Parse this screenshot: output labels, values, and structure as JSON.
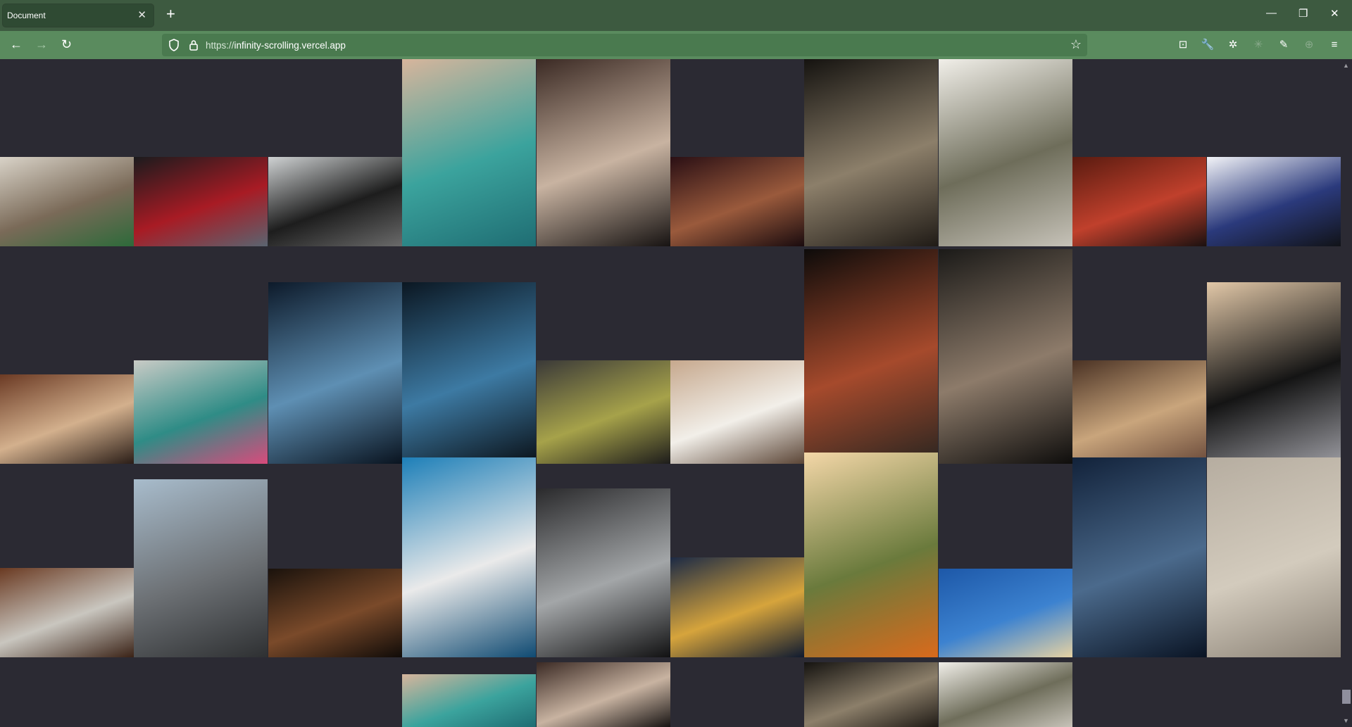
{
  "browser": {
    "tab_title": "Document",
    "tab_close": "✕",
    "new_tab": "+",
    "url_scheme": "https://",
    "url_host": "infinity-scrolling.vercel.app",
    "window_controls": {
      "minimize": "—",
      "restore": "❐",
      "close": "✕"
    },
    "nav": {
      "back": "←",
      "forward": "→",
      "reload": "↻"
    },
    "bookmark": "☆",
    "toolbar_icons": [
      "pocket-icon",
      "wrench-icon",
      "extension-icon",
      "disabled-extension-icon",
      "eyedropper-icon",
      "crosshair-icon",
      "menu-icon"
    ],
    "toolbar_glyphs": [
      "⊡",
      "🔧",
      "✲",
      "✳",
      "✎",
      "⊕",
      "≡"
    ]
  },
  "gallery": {
    "description_visible": false,
    "tiles": [
      {
        "name": "photo-laptop-plant-desk",
        "grad": [
          "#d9d3c8",
          "#7a6a58",
          "#2d6a3a"
        ]
      },
      {
        "name": "photo-red-poster-window",
        "grad": [
          "#1b1b1d",
          "#a81b24",
          "#5a6470"
        ]
      },
      {
        "name": "photo-office-windows",
        "grad": [
          "#cfd2d3",
          "#1d1d1d",
          "#6a6a6a"
        ]
      },
      {
        "name": "photo-aerial-beach",
        "grad": [
          "#d7b59c",
          "#3ba39d",
          "#1f6d73"
        ]
      },
      {
        "name": "photo-wedding-couple",
        "grad": [
          "#3b2a24",
          "#c8b3a1",
          "#171312"
        ]
      },
      {
        "name": "photo-coin-stack",
        "grad": [
          "#2a0f14",
          "#9a5a3c",
          "#1a0b0e"
        ]
      },
      {
        "name": "photo-gothic-window-city",
        "grad": [
          "#151310",
          "#8c7f6a",
          "#201b16"
        ]
      },
      {
        "name": "photo-dining-room",
        "grad": [
          "#f1efe9",
          "#6e6d5a",
          "#c6c2b8"
        ]
      },
      {
        "name": "photo-man-red-flannel",
        "grad": [
          "#5a1b10",
          "#c0402c",
          "#1c1110"
        ]
      },
      {
        "name": "photo-abstract-ink",
        "grad": [
          "#f3f4f8",
          "#2b3a7c",
          "#111318"
        ]
      },
      {
        "name": "photo-laptop-round-table",
        "grad": [
          "#6b3a24",
          "#d3b08d",
          "#2a1d17"
        ]
      },
      {
        "name": "photo-mountain-lake",
        "grad": [
          "#c9cbc6",
          "#2f8c86",
          "#d84b7c"
        ]
      },
      {
        "name": "photo-night-building-blue",
        "grad": [
          "#0d1a2a",
          "#5e8fb3",
          "#09131f"
        ]
      },
      {
        "name": "photo-dark-skyscraper",
        "grad": [
          "#0b1722",
          "#3d7aa3",
          "#0a1118"
        ]
      },
      {
        "name": "photo-great-tit-bird",
        "grad": [
          "#3a3938",
          "#a6a24a",
          "#1d1c1b"
        ]
      },
      {
        "name": "photo-people-laptops",
        "grad": [
          "#c6a88d",
          "#f2efe9",
          "#5b4536"
        ]
      },
      {
        "name": "photo-night-street-shop",
        "grad": [
          "#0d0b0a",
          "#a64a2c",
          "#2a2520"
        ]
      },
      {
        "name": "photo-elevated-train-street",
        "grad": [
          "#1b1a18",
          "#8d7b6a",
          "#0e0d0c"
        ]
      },
      {
        "name": "photo-cookies-table",
        "grad": [
          "#4a3224",
          "#c9a57c",
          "#6a4a3a"
        ]
      },
      {
        "name": "photo-woman-checkered-pants",
        "grad": [
          "#e2c8a8",
          "#141414",
          "#9a9aa0"
        ]
      },
      {
        "name": "photo-laptop-leather-sofa",
        "grad": [
          "#6a3a22",
          "#c9c6bf",
          "#3a2216"
        ]
      },
      {
        "name": "photo-new-york-skyline",
        "grad": [
          "#a8bccc",
          "#6d7175",
          "#2e3032"
        ]
      },
      {
        "name": "photo-sand-dune-dark",
        "grad": [
          "#1a120c",
          "#7a4a2a",
          "#100b08"
        ]
      },
      {
        "name": "photo-blue-skyscraper-plane",
        "grad": [
          "#1d7fb8",
          "#eaeaea",
          "#0f4a72"
        ]
      },
      {
        "name": "photo-escalator",
        "grad": [
          "#2a2a2c",
          "#a3a6a8",
          "#111112"
        ]
      },
      {
        "name": "photo-crypto-phone-coins",
        "grad": [
          "#1c2a45",
          "#d6a43c",
          "#0f1a30"
        ]
      },
      {
        "name": "photo-sunset-river-woman",
        "grad": [
          "#f4d7a8",
          "#6a7a3c",
          "#d96a1c"
        ]
      },
      {
        "name": "photo-blue-sky-dune",
        "grad": [
          "#1d58a8",
          "#3c82d0",
          "#e6d2a3"
        ]
      },
      {
        "name": "photo-snowy-cabin-night",
        "grad": [
          "#12223a",
          "#4b6a8c",
          "#0a1424"
        ]
      },
      {
        "name": "photo-handwritten-letter",
        "grad": [
          "#b6ada0",
          "#d3cbbd",
          "#8a8175"
        ]
      }
    ]
  }
}
